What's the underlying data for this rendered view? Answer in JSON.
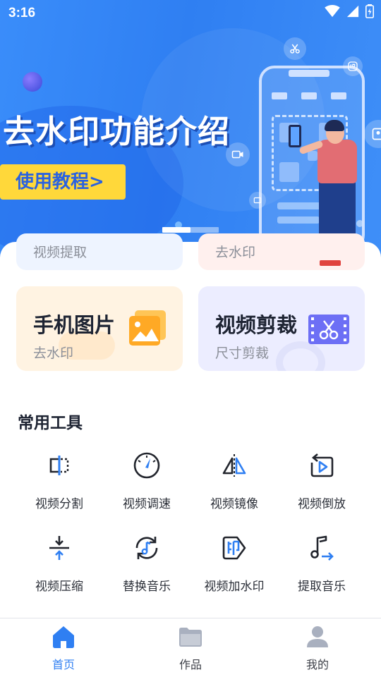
{
  "status_bar": {
    "time": "3:16"
  },
  "banner": {
    "title": "去水印功能介绍",
    "button_label": "使用教程>",
    "indicator_count": 2,
    "active_indicator": 0
  },
  "cards": {
    "partial_left_sub": "视频提取",
    "partial_right_sub": "去水印",
    "phone_photo": {
      "title": "手机图片",
      "sub": "去水印"
    },
    "video_crop": {
      "title": "视频剪裁",
      "sub": "尺寸剪裁"
    }
  },
  "tools": {
    "section_title": "常用工具",
    "items": [
      {
        "label": "视频分割",
        "icon": "video-split-icon"
      },
      {
        "label": "视频调速",
        "icon": "speed-gauge-icon"
      },
      {
        "label": "视频镜像",
        "icon": "mirror-icon"
      },
      {
        "label": "视频倒放",
        "icon": "reverse-play-icon"
      },
      {
        "label": "视频压缩",
        "icon": "compress-icon"
      },
      {
        "label": "替换音乐",
        "icon": "replace-music-icon"
      },
      {
        "label": "视频加水印",
        "icon": "add-watermark-icon"
      },
      {
        "label": "提取音乐",
        "icon": "extract-music-icon"
      }
    ]
  },
  "nav": {
    "items": [
      {
        "label": "首页",
        "icon": "home-icon",
        "active": true
      },
      {
        "label": "作品",
        "icon": "folder-icon",
        "active": false
      },
      {
        "label": "我的",
        "icon": "profile-icon",
        "active": false
      }
    ]
  },
  "colors": {
    "accent": "#2f7ff2",
    "banner_button": "#ffd83a",
    "nav_active": "#2f7ff2",
    "nav_inactive": "#3c3f47"
  }
}
